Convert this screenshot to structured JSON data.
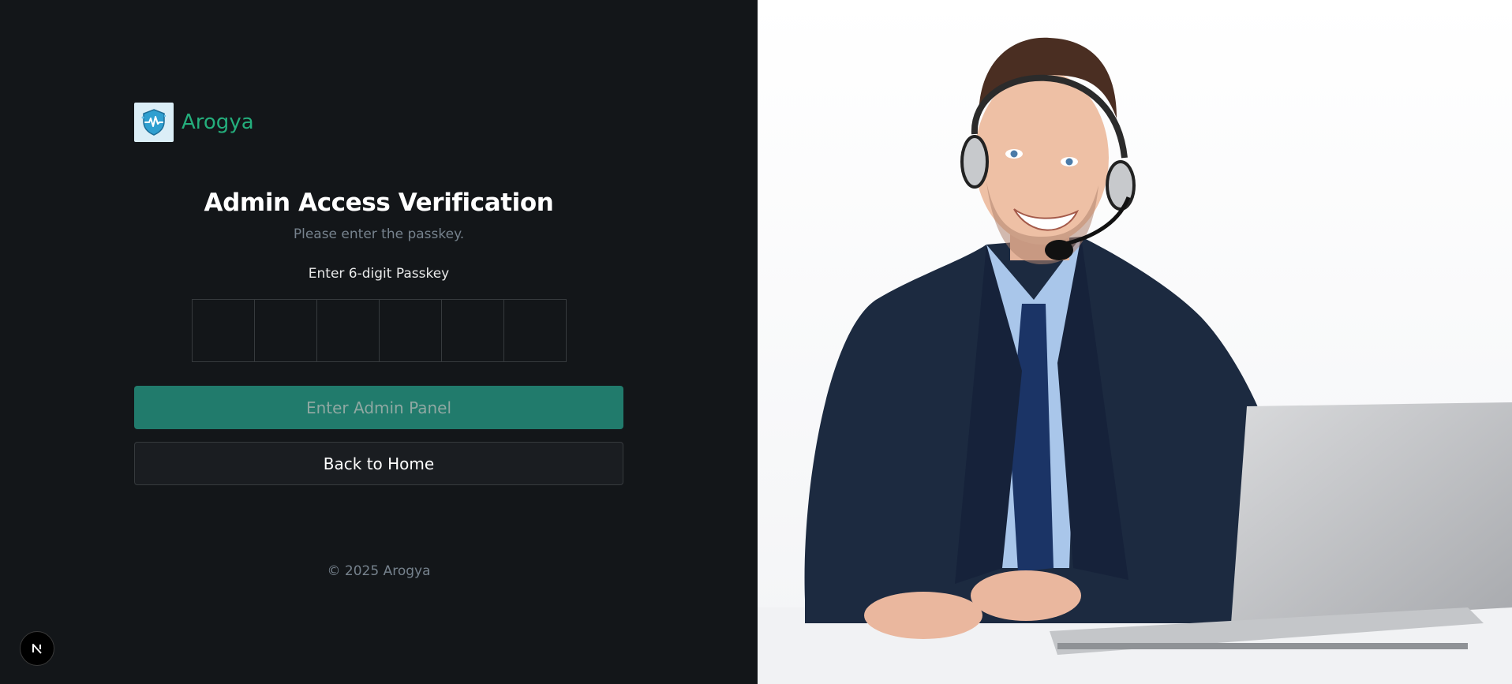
{
  "brand": {
    "name": "Arogya",
    "logo_icon": "shield-heartbeat-icon"
  },
  "form": {
    "title": "Admin Access Verification",
    "subtitle": "Please enter the passkey.",
    "otp_label": "Enter 6-digit Passkey",
    "otp_slots": [
      "",
      "",
      "",
      "",
      "",
      ""
    ],
    "submit_label": "Enter Admin Panel",
    "back_label": "Back to Home"
  },
  "footer": {
    "copyright": "© 2025 Arogya"
  },
  "dev_badge": {
    "letter": "N"
  },
  "colors": {
    "accent": "#24ae7c",
    "button_primary": "#217b6c",
    "background": "#131619"
  }
}
